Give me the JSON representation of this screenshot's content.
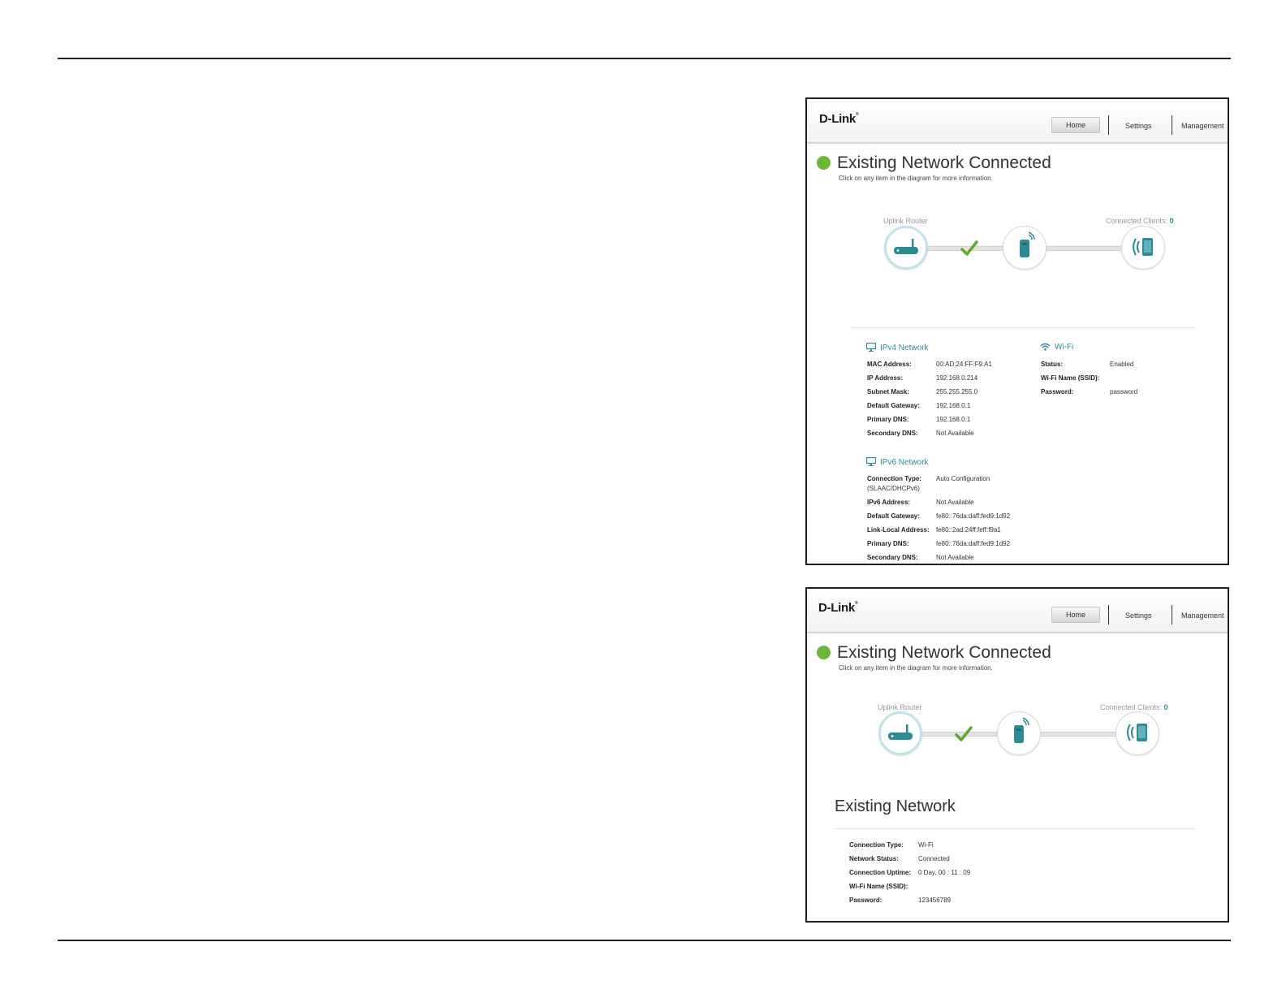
{
  "header": {
    "logo": "D-Link",
    "nav": {
      "home": "Home",
      "settings": "Settings",
      "management": "Management"
    }
  },
  "status": {
    "title": "Existing Network Connected",
    "subtitle": "Click on any item in the diagram for more information."
  },
  "diagram": {
    "uplink_label": "Uplink Router",
    "clients_label": "Connected Clients:",
    "clients_count": "0"
  },
  "ipv4": {
    "title": "IPv4 Network",
    "rows": [
      {
        "key": "MAC Address:",
        "value": "00:AD:24:FF:F9:A1"
      },
      {
        "key": "IP Address:",
        "value": "192.168.0.214"
      },
      {
        "key": "Subnet Mask:",
        "value": "255.255.255.0"
      },
      {
        "key": "Default Gateway:",
        "value": "192.168.0.1"
      },
      {
        "key": "Primary DNS:",
        "value": "192.168.0.1"
      },
      {
        "key": "Secondary DNS:",
        "value": "Not Available"
      }
    ]
  },
  "wifi": {
    "title": "Wi-Fi",
    "rows": [
      {
        "key": "Status:",
        "value": "Enabled"
      },
      {
        "key": "Wi-Fi Name (SSID):",
        "value": ""
      },
      {
        "key": "Password:",
        "value": "password"
      }
    ]
  },
  "ipv6": {
    "title": "IPv6 Network",
    "connection_type_key": "Connection Type:",
    "connection_type_key2": "(SLAAC/DHCPv6)",
    "connection_type_value": "Auto Configuration",
    "rows": [
      {
        "key": "IPv6 Address:",
        "value": "Not Available"
      },
      {
        "key": "Default Gateway:",
        "value": "fe80::76da:daff:fed9:1d92"
      },
      {
        "key": "Link-Local Address:",
        "value": "fe80::2ad:24ff:feff:f9a1"
      },
      {
        "key": "Primary DNS:",
        "value": "fe80::76da:daff:fed9:1d92"
      },
      {
        "key": "Secondary DNS:",
        "value": "Not Available"
      }
    ]
  },
  "existing_network": {
    "title": "Existing Network",
    "rows": [
      {
        "key": "Connection Type:",
        "value": "Wi-Fi"
      },
      {
        "key": "Network Status:",
        "value": "Connected"
      },
      {
        "key": "Connection Uptime:",
        "value": "0 Day,  00 : 11 : 09"
      },
      {
        "key": "Wi-Fi Name (SSID):",
        "value": ""
      },
      {
        "key": "Password:",
        "value": "123456789"
      }
    ]
  },
  "colors": {
    "accent": "#2c8c95",
    "status_green": "#6bb736",
    "check_green": "#5aab2e"
  }
}
